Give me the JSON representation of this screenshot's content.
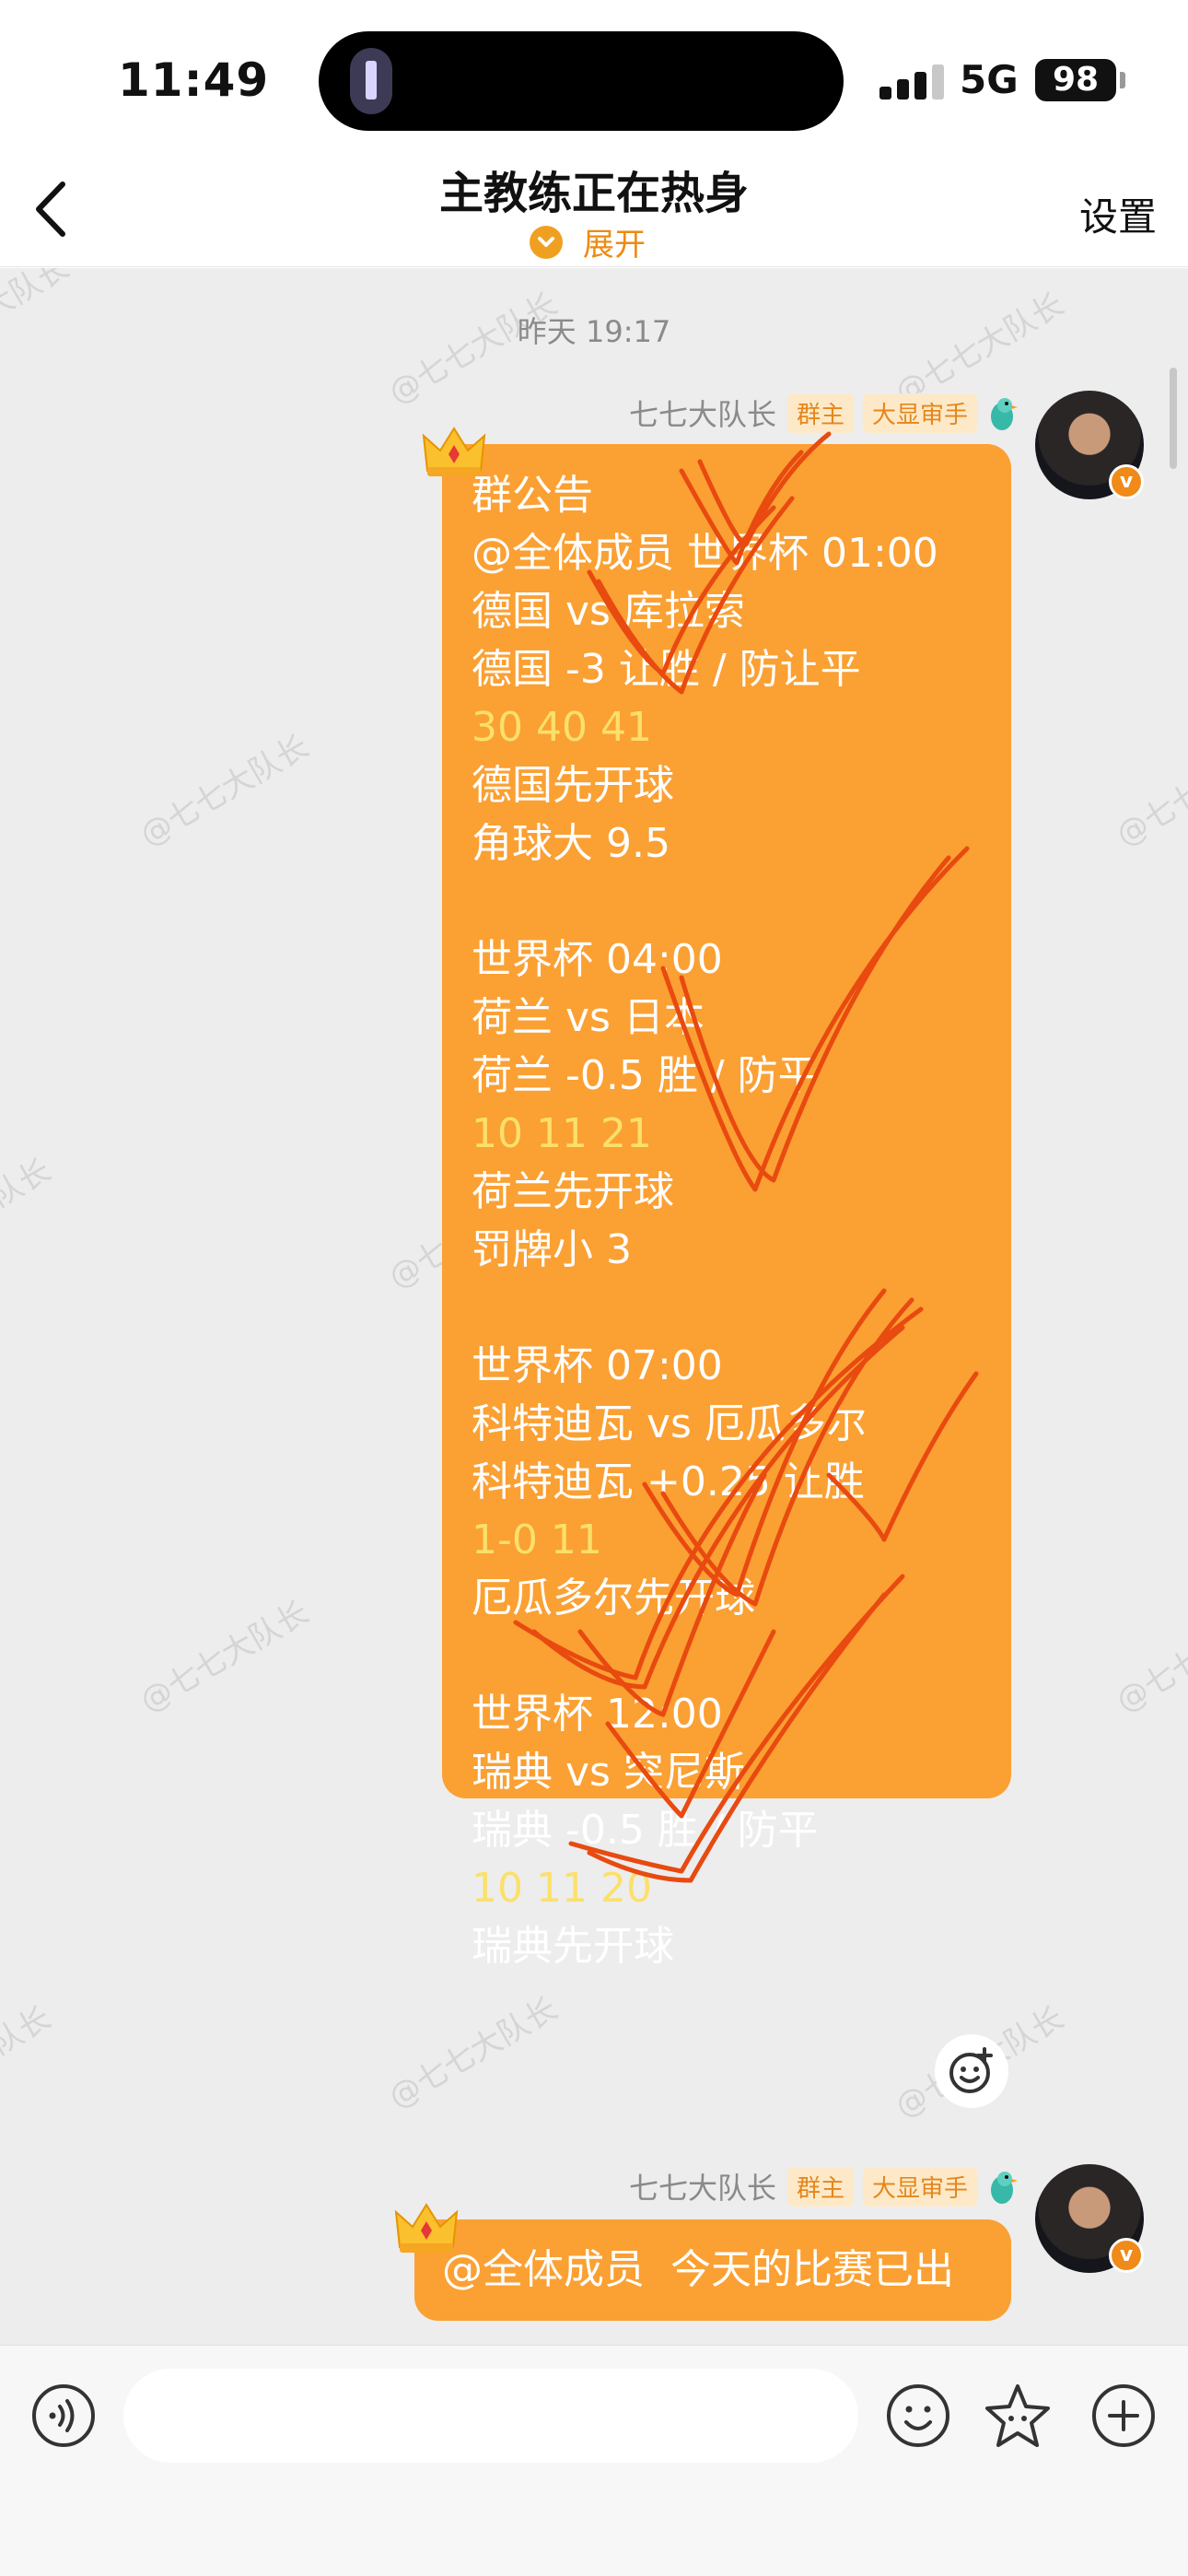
{
  "status_bar": {
    "time": "11:49",
    "network": "5G",
    "battery": "98"
  },
  "header": {
    "back_icon": "chevron-left-icon",
    "title": "主教练正在热身",
    "expand_label": "展开",
    "settings_label": "设置"
  },
  "chat": {
    "timestamp": "昨天 19:17",
    "watermark": "@七七大队长",
    "messages": [
      {
        "sender": "七七大队长",
        "badges": [
          "群主",
          "大显审手"
        ],
        "lines": [
          {
            "text": "群公告",
            "gold": false
          },
          {
            "text": "@全体成员 世界杯 01:00",
            "gold": false
          },
          {
            "text": "德国 vs 库拉索",
            "gold": false
          },
          {
            "text": "德国 -3 让胜 / 防让平",
            "gold": false
          },
          {
            "text": "30 40 41",
            "gold": true
          },
          {
            "text": "德国先开球",
            "gold": false
          },
          {
            "text": "角球大 9.5",
            "gold": false
          },
          {
            "text": "",
            "gold": false
          },
          {
            "text": "世界杯 04:00",
            "gold": false
          },
          {
            "text": "荷兰 vs 日本",
            "gold": false
          },
          {
            "text": "荷兰 -0.5 胜 / 防平",
            "gold": false
          },
          {
            "text": "10 11 21",
            "gold": true
          },
          {
            "text": "荷兰先开球",
            "gold": false
          },
          {
            "text": "罚牌小 3",
            "gold": false
          },
          {
            "text": "",
            "gold": false
          },
          {
            "text": "世界杯 07:00",
            "gold": false
          },
          {
            "text": "科特迪瓦 vs 厄瓜多尔",
            "gold": false
          },
          {
            "text": "科特迪瓦 +0.25 让胜",
            "gold": false
          },
          {
            "text": "1-0 11",
            "gold": true
          },
          {
            "text": "厄瓜多尔先开球",
            "gold": false
          },
          {
            "text": "",
            "gold": false
          },
          {
            "text": "世界杯 12:00",
            "gold": false
          },
          {
            "text": "瑞典 vs 突尼斯",
            "gold": false
          },
          {
            "text": "瑞典 -0.5 胜 / 防平",
            "gold": false
          },
          {
            "text": "10 11 20",
            "gold": true
          },
          {
            "text": "瑞典先开球",
            "gold": false
          }
        ]
      },
      {
        "sender": "七七大队长",
        "badges": [
          "群主",
          "大显审手"
        ],
        "text": "@全体成员  今天的比赛已出"
      }
    ]
  },
  "input_bar": {
    "voice_icon": "voice-icon",
    "emoji_icon": "emoji-icon",
    "sticker_icon": "star-sticker-icon",
    "plus_icon": "plus-icon",
    "placeholder": ""
  },
  "colors": {
    "bubble": "#fba033",
    "gold_text": "#fbe06a",
    "accent": "#ee8a10",
    "tick_stroke": "#e84a10",
    "chat_bg": "#ededed"
  }
}
